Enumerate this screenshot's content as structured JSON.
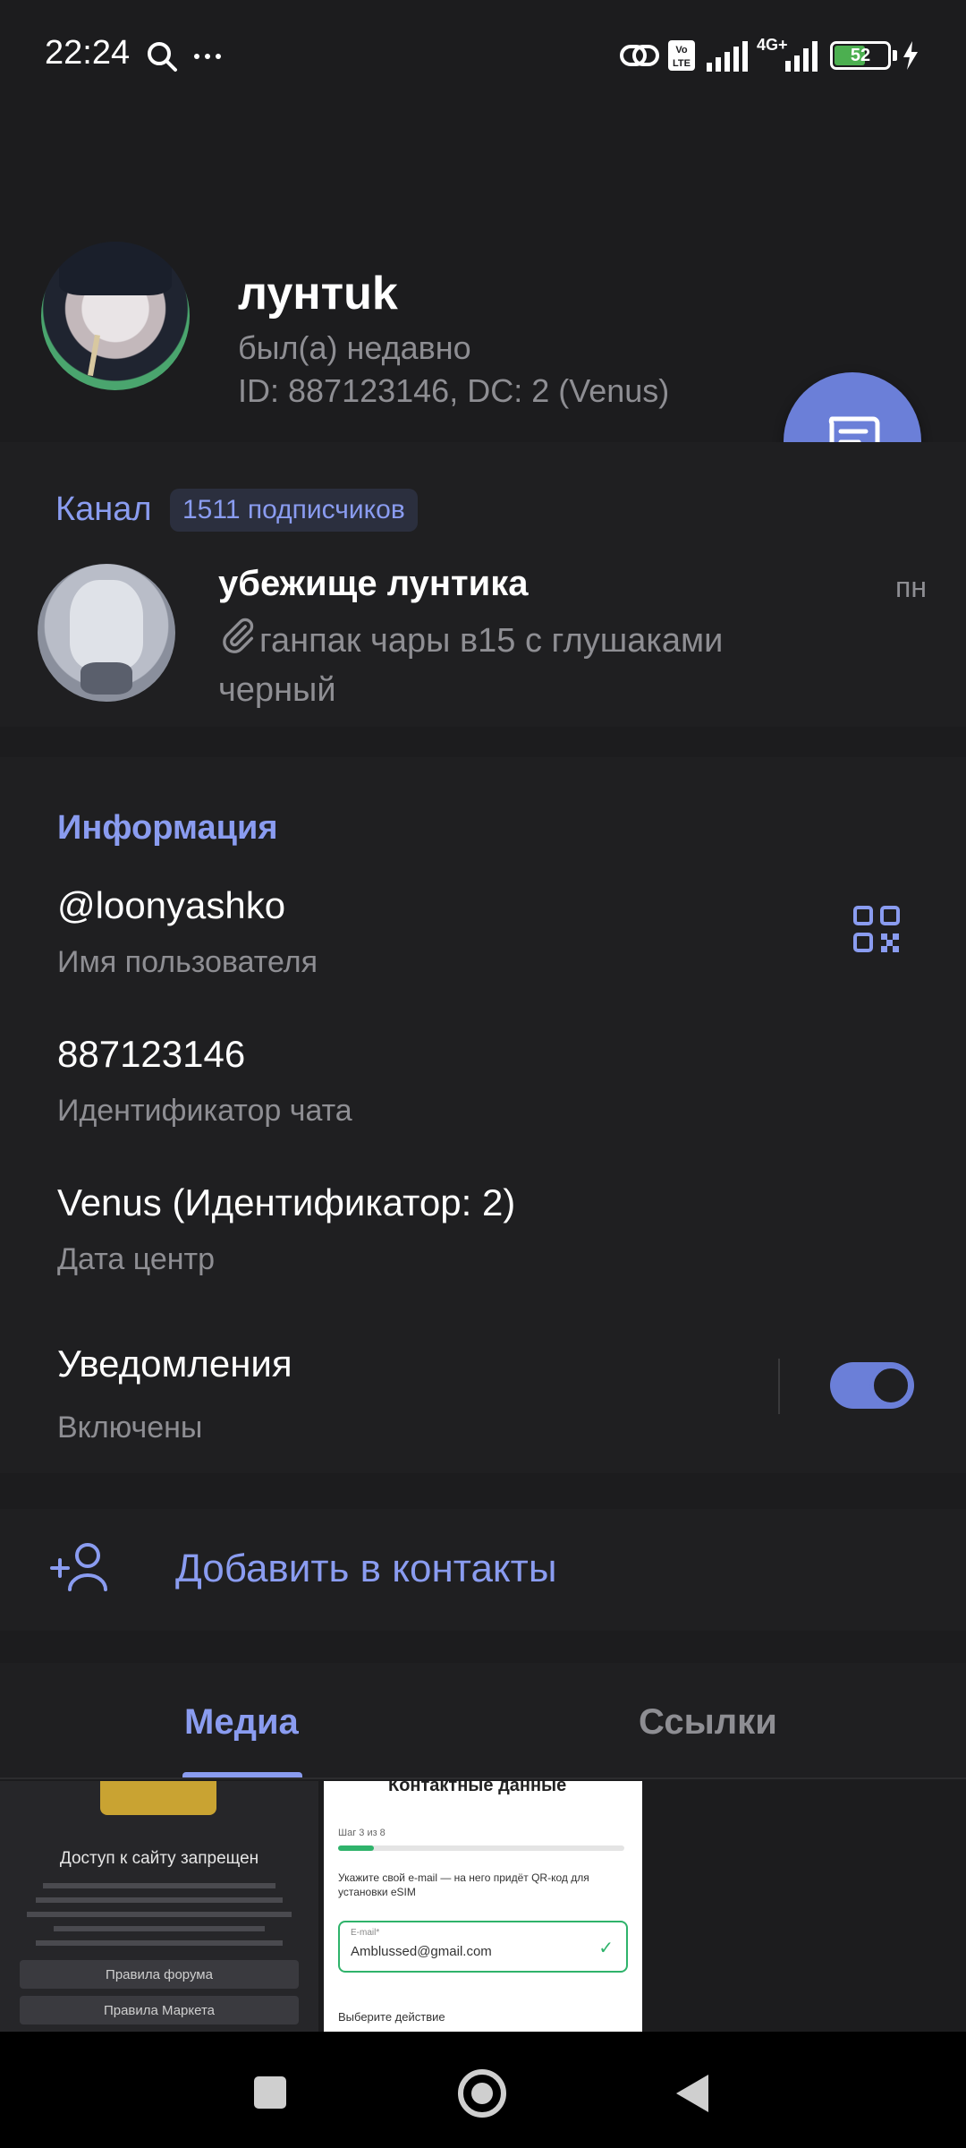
{
  "status_bar": {
    "time": "22:24",
    "network": "4G+",
    "battery": "52",
    "icons": [
      "search-icon",
      "more-icon",
      "link-icon",
      "volte-icon",
      "signal-icon",
      "battery-icon",
      "charging-icon"
    ]
  },
  "profile": {
    "name": "лунтuk",
    "last_seen": "был(а) недавно",
    "id_line": "ID: 887123146, DC: 2 (Venus)"
  },
  "channel": {
    "label": "Канал",
    "subscribers": "1511 подписчиков",
    "title": "убежище лунтика",
    "date": "пн",
    "message": "ганпак чары в15 с глушаками черный"
  },
  "info": {
    "header": "Информация",
    "username": "@loonyashko",
    "username_label": "Имя пользователя",
    "chat_id": "887123146",
    "chat_id_label": "Идентификатор чата",
    "dc": "Venus (Идентификатор: 2)",
    "dc_label": "Дата центр",
    "notifications": "Уведомления",
    "notifications_state": "Включены",
    "notifications_on": true
  },
  "add_contact": {
    "label": "Добавить в контакты"
  },
  "tabs": {
    "media": "Медиа",
    "links": "Ссылки",
    "active": "Медиа"
  },
  "media": {
    "thumb1": {
      "heading": "Доступ к сайту запрещен",
      "button1": "Правила форума",
      "button2": "Правила Маркета"
    },
    "thumb2": {
      "heading": "Контактные данные",
      "step": "Шаг 3 из 8",
      "text": "Укажите свой e-mail — на него придёт QR-код для установки eSIM",
      "field_label": "E-mail*",
      "email": "Amblussed@gmail.com",
      "action": "Выберите действие"
    }
  },
  "colors": {
    "background": "#1c1c1e",
    "section": "#1f1f21",
    "accent": "#8a9cf0",
    "fab": "#6b7fd8",
    "secondary_text": "#8e8e93"
  }
}
